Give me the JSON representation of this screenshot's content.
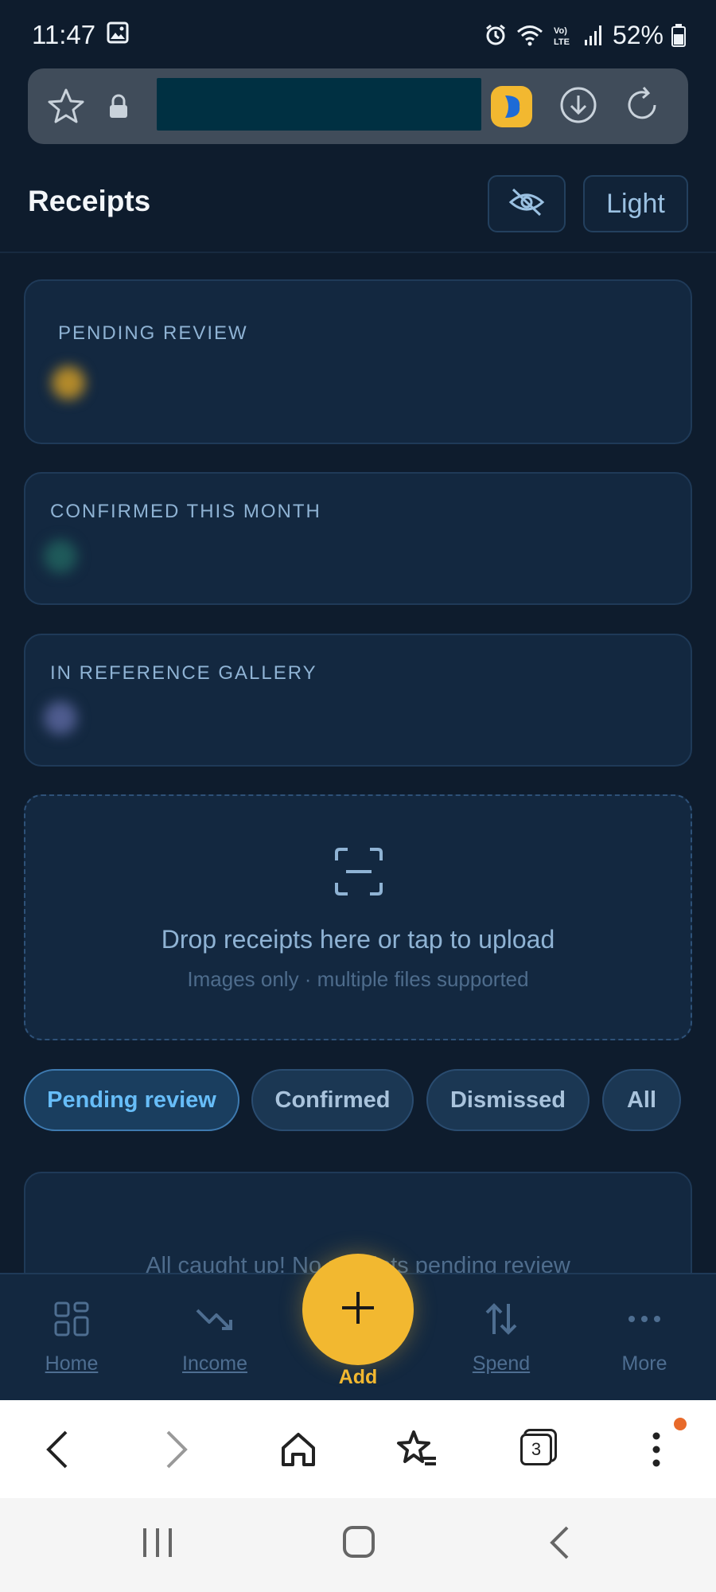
{
  "status_bar": {
    "time": "11:47",
    "battery": "52%",
    "icons": [
      "gallery-icon",
      "alarm-icon",
      "wifi-icon",
      "volte-icon",
      "signal-icon",
      "battery-icon"
    ]
  },
  "browser": {
    "address_bar": {
      "icons": [
        "bookmark-star-icon",
        "lock-icon",
        "extension-icon",
        "download-icon",
        "reload-icon"
      ]
    },
    "toolbar": {
      "icons": [
        "back-icon",
        "forward-icon",
        "home-icon",
        "bookmarks-icon",
        "tabs-icon",
        "menu-icon"
      ],
      "tabs_count": "3"
    }
  },
  "header": {
    "title": "Receipts",
    "theme_toggle_label": "Light",
    "hide_icon": "eye-off-icon"
  },
  "stats": [
    {
      "label": "PENDING REVIEW",
      "color": "#b38a2a"
    },
    {
      "label": "CONFIRMED THIS MONTH",
      "color": "#1f5a5a"
    },
    {
      "label": "IN REFERENCE GALLERY",
      "color": "#4f5c8f"
    }
  ],
  "drop_zone": {
    "icon": "scan-icon",
    "title": "Drop receipts here or tap to upload",
    "subtitle": "Images only · multiple files supported"
  },
  "filters": [
    {
      "label": "Pending review",
      "active": true
    },
    {
      "label": "Confirmed",
      "active": false
    },
    {
      "label": "Dismissed",
      "active": false
    },
    {
      "label": "All",
      "active": false
    }
  ],
  "list": {
    "empty_message": "All caught up! No receipts pending review"
  },
  "bottom_nav": {
    "items": [
      {
        "label": "Home",
        "icon": "grid-icon"
      },
      {
        "label": "Income",
        "icon": "trend-down-icon"
      },
      {
        "label": "Add",
        "icon": "plus-icon"
      },
      {
        "label": "Spend",
        "icon": "arrows-updown-icon"
      },
      {
        "label": "More",
        "icon": "more-dots-icon"
      }
    ]
  },
  "colors": {
    "background": "#0e1c2d",
    "card": "#132840",
    "accent": "#f2b830",
    "active_filter_text": "#67bdf8"
  }
}
